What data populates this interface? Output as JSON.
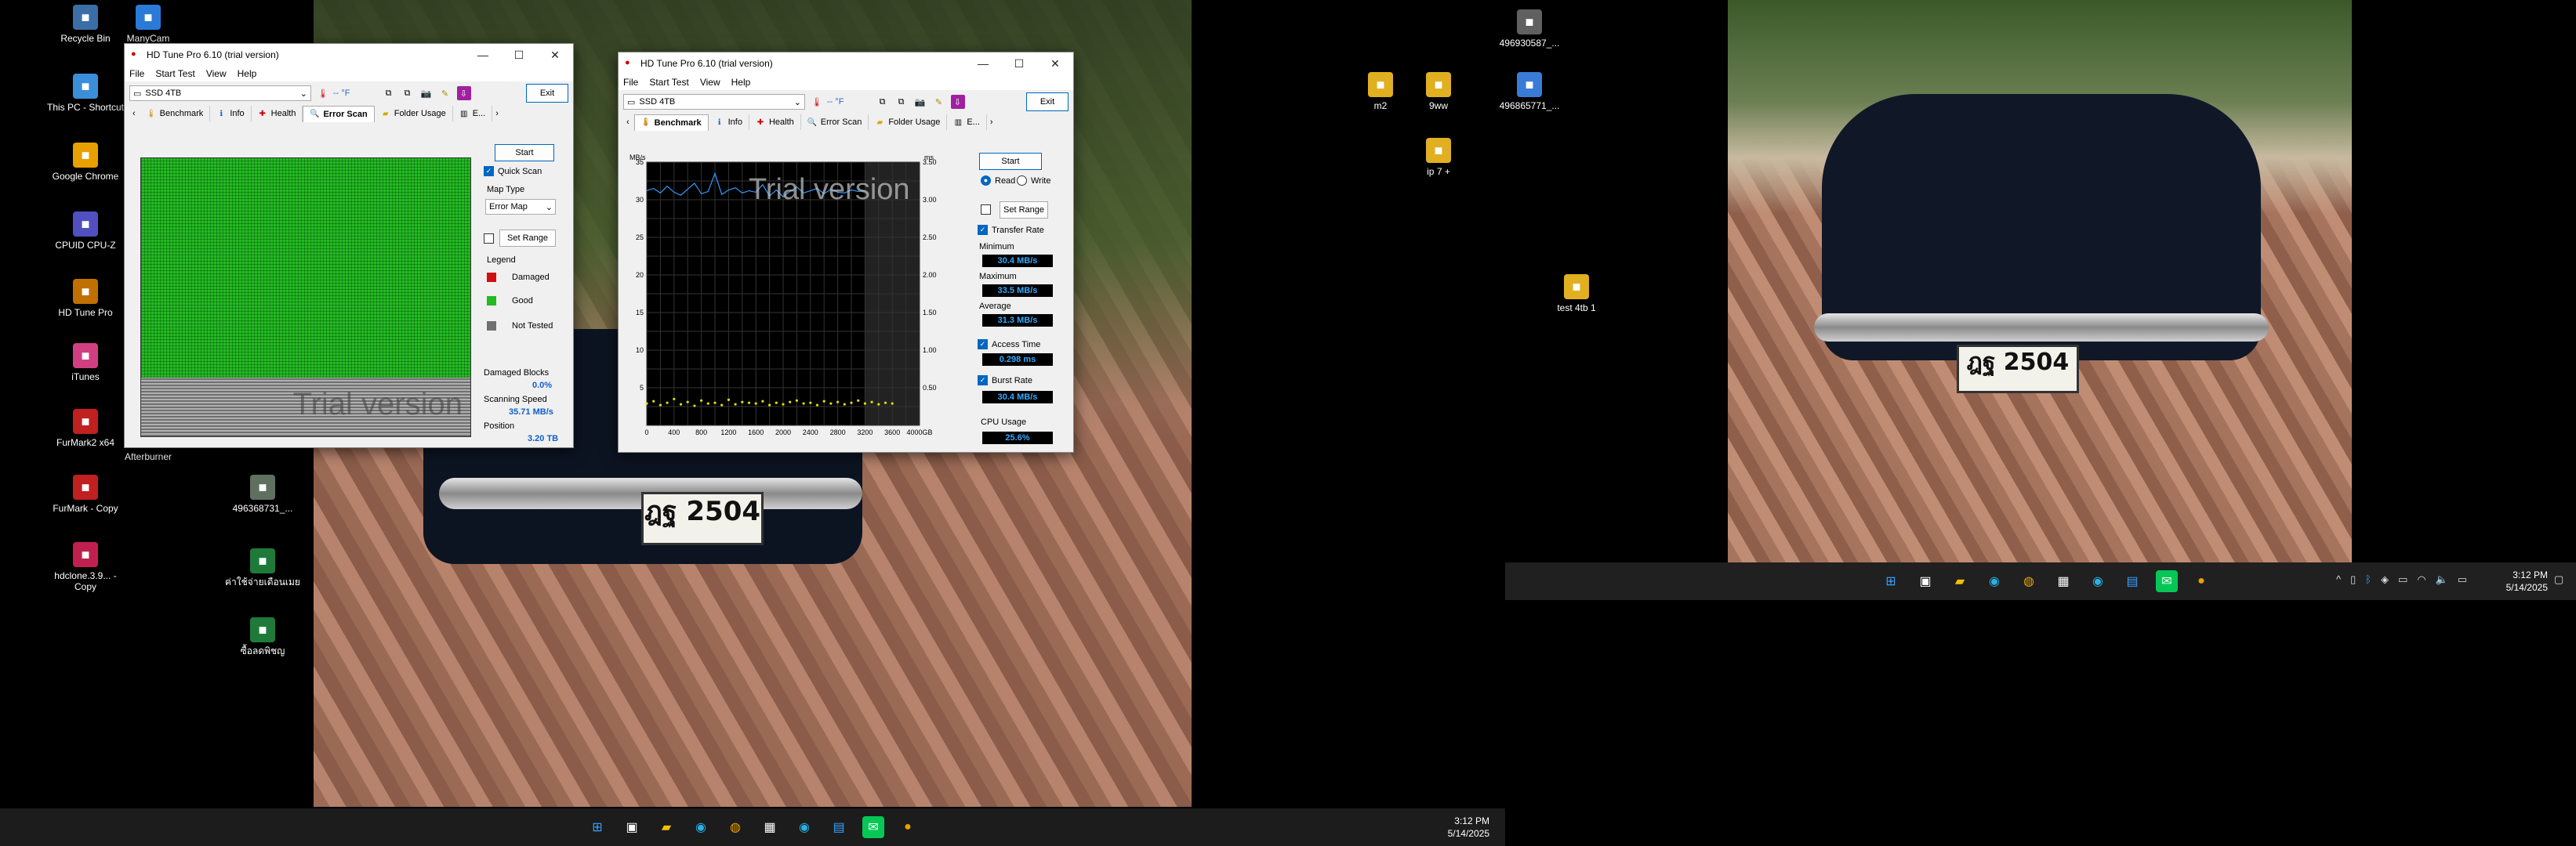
{
  "desktop_left": {
    "icons": [
      {
        "label": "Recycle Bin",
        "icon": "recycle-bin-icon"
      },
      {
        "label": "ManyCam",
        "icon": "manycam-icon"
      },
      {
        "label": "This PC - Shortcut",
        "icon": "this-pc-icon"
      },
      {
        "label": "Google Chrome",
        "icon": "chrome-icon"
      },
      {
        "label": "CPUID CPU-Z",
        "icon": "cpuz-icon"
      },
      {
        "label": "HD Tune Pro",
        "icon": "hdtune-icon"
      },
      {
        "label": "iTunes",
        "icon": "itunes-icon"
      },
      {
        "label": "FurMark2 x64",
        "icon": "furmark-icon"
      },
      {
        "label": "Afterburner",
        "icon": "afterburner-icon"
      },
      {
        "label": "FurMark - Copy",
        "icon": "furmark-copy-icon"
      },
      {
        "label": "hdclone.3.9... - Copy",
        "icon": "hdclone-icon"
      },
      {
        "label": "496368731_...",
        "icon": "image-file-icon"
      },
      {
        "label": "ค่าใช้จ่ายเดือนเมย",
        "icon": "sheet-file-icon"
      },
      {
        "label": "ซื้อลดพิชญ",
        "icon": "sheet-file-icon"
      }
    ]
  },
  "desktop_right": {
    "icons": [
      {
        "label": "496930587_...",
        "icon": "image-file-icon"
      },
      {
        "label": "m2",
        "icon": "folder-icon"
      },
      {
        "label": "9ww",
        "icon": "folder-icon"
      },
      {
        "label": "496865771_...",
        "icon": "doc-file-icon"
      },
      {
        "label": "ip 7 +",
        "icon": "folder-icon"
      },
      {
        "label": "test 4tb 1",
        "icon": "folder-icon"
      }
    ]
  },
  "window1": {
    "title": "HD Tune Pro 6.10 (trial version)",
    "menu": [
      "File",
      "Start Test",
      "View",
      "Help"
    ],
    "drive": "SSD 4TB",
    "temp": "-- °F",
    "exit": "Exit",
    "tabs": [
      "Benchmark",
      "Info",
      "Health",
      "Error Scan",
      "Folder Usage",
      "E..."
    ],
    "active_tab": "Error Scan",
    "start": "Start",
    "quick_scan": "Quick Scan",
    "map_type_label": "Map Type",
    "map_type_value": "Error Map",
    "set_range": "Set Range",
    "legend_title": "Legend",
    "legend": [
      {
        "label": "Damaged",
        "color": "#d01010"
      },
      {
        "label": "Good",
        "color": "#22bb22"
      },
      {
        "label": "Not Tested",
        "color": "#707070"
      }
    ],
    "damaged_blocks_label": "Damaged Blocks",
    "damaged_blocks_value": "0.0%",
    "scanning_speed_label": "Scanning Speed",
    "scanning_speed_value": "35.71 MB/s",
    "position_label": "Position",
    "position_value": "3.20 TB",
    "watermark": "Trial version",
    "progress_fraction": 0.79
  },
  "window2": {
    "title": "HD Tune Pro 6.10 (trial version)",
    "menu": [
      "File",
      "Start Test",
      "View",
      "Help"
    ],
    "drive": "SSD 4TB",
    "temp": "-- °F",
    "exit": "Exit",
    "tabs": [
      "Benchmark",
      "Info",
      "Health",
      "Error Scan",
      "Folder Usage",
      "E..."
    ],
    "active_tab": "Benchmark",
    "start": "Start",
    "read": "Read",
    "write": "Write",
    "set_range": "Set Range",
    "transfer_rate": "Transfer Rate",
    "minimum_label": "Minimum",
    "minimum_value": "30.4 MB/s",
    "maximum_label": "Maximum",
    "maximum_value": "33.5 MB/s",
    "average_label": "Average",
    "average_value": "31.3 MB/s",
    "access_time": "Access Time",
    "access_time_value": "0.298 ms",
    "burst_rate": "Burst Rate",
    "burst_rate_value": "30.4 MB/s",
    "cpu_usage_label": "CPU Usage",
    "cpu_usage_value": "25.6%",
    "watermark": "Trial version"
  },
  "chart_data": {
    "type": "line",
    "title": "",
    "xlabel": "GB",
    "ylabel": "MB/s",
    "y2label": "ms",
    "x_ticks": [
      "0",
      "400",
      "800",
      "1200",
      "1600",
      "2000",
      "2400",
      "2800",
      "3200",
      "3600",
      "4000GB"
    ],
    "y_ticks": [
      "35",
      "30",
      "25",
      "20",
      "15",
      "10",
      "5"
    ],
    "y2_ticks": [
      "3.50",
      "3.00",
      "2.50",
      "2.00",
      "1.50",
      "1.00",
      "0.50"
    ],
    "xlim": [
      0,
      4000
    ],
    "ylim": [
      0,
      35
    ],
    "y2lim": [
      0,
      3.5
    ],
    "grid": true,
    "series": [
      {
        "name": "Transfer Rate",
        "color": "#3399ff",
        "x": [
          0,
          100,
          200,
          300,
          400,
          500,
          600,
          700,
          800,
          900,
          1000,
          1100,
          1200,
          1300,
          1400,
          1500,
          1600,
          1700,
          1800,
          1900,
          2000,
          2100,
          2200,
          2300,
          2400,
          2500,
          2600,
          2700,
          2800,
          2900,
          3000,
          3100,
          3200
        ],
        "y": [
          31.2,
          31.5,
          30.9,
          31.8,
          31.0,
          30.6,
          31.4,
          32.2,
          30.8,
          31.1,
          33.5,
          30.7,
          31.3,
          31.6,
          30.9,
          31.2,
          31.0,
          32.0,
          30.5,
          31.3,
          30.4,
          31.1,
          31.7,
          30.9,
          31.2,
          31.5,
          30.8,
          31.4,
          31.0,
          30.9,
          31.3,
          31.1,
          31.2
        ]
      },
      {
        "name": "Access Time",
        "color": "#dddd00",
        "x": [
          0,
          100,
          200,
          300,
          400,
          500,
          600,
          700,
          800,
          900,
          1000,
          1100,
          1200,
          1300,
          1400,
          1500,
          1600,
          1700,
          1800,
          1900,
          2000,
          2100,
          2200,
          2300,
          2400,
          2500,
          2600,
          2700,
          2800,
          2900,
          3000,
          3100,
          3200,
          3300,
          3400,
          3500,
          3600
        ],
        "y": [
          0.29,
          0.32,
          0.27,
          0.3,
          0.35,
          0.28,
          0.31,
          0.26,
          0.33,
          0.29,
          0.3,
          0.27,
          0.34,
          0.28,
          0.31,
          0.3,
          0.29,
          0.32,
          0.27,
          0.3,
          0.28,
          0.31,
          0.33,
          0.29,
          0.3,
          0.27,
          0.32,
          0.29,
          0.31,
          0.28,
          0.3,
          0.33,
          0.29,
          0.31,
          0.28,
          0.3,
          0.29
        ]
      }
    ]
  },
  "taskbar_left": {
    "time": "3:12 PM",
    "date": "5/14/2025"
  },
  "taskbar_right": {
    "time": "3:12 PM",
    "date": "5/14/2025"
  }
}
